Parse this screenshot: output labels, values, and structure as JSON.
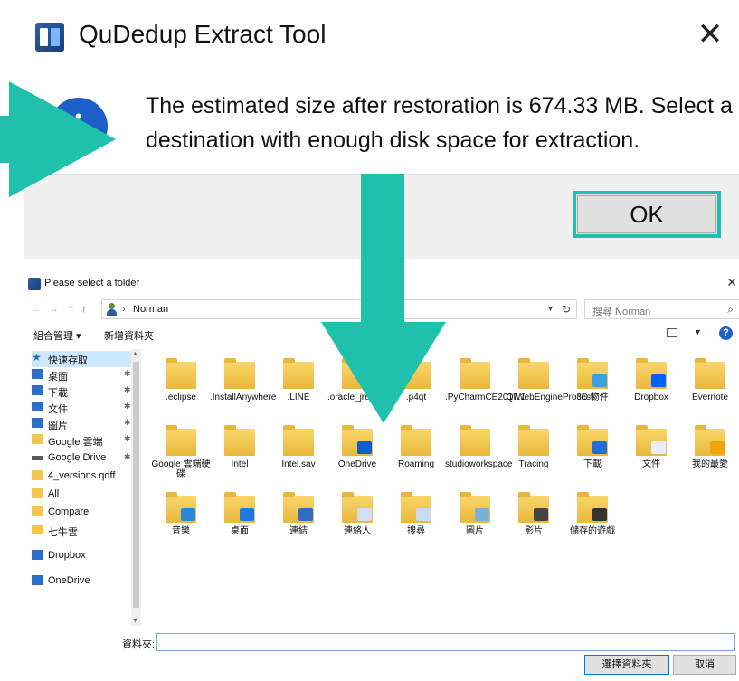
{
  "message_dialog": {
    "title": "QuDedup Extract Tool",
    "close_glyph": "✕",
    "icon": "info-icon",
    "message": "The estimated size after restoration is 674.33 MB. Select a destination with enough disk space for extraction.",
    "ok_label": "OK"
  },
  "annotation_color": "#1fc1ad",
  "folder_picker": {
    "title": "Please select a folder",
    "close_glyph": "✕",
    "nav": {
      "back": "←",
      "forward": "→",
      "recent": "⌄",
      "up": "↑",
      "path_sep": "›",
      "path": "Norman",
      "refresh": "↻"
    },
    "search_placeholder": "搜尋 Norman",
    "toolbar": {
      "organize": "組合管理 ▾",
      "new_folder": "新增資料夾"
    },
    "sidebar": [
      {
        "label": "快速存取",
        "icon": "star-icon",
        "pinned": false
      },
      {
        "label": "桌面",
        "icon": "desktop-icon",
        "pinned": true
      },
      {
        "label": "下載",
        "icon": "download-icon",
        "pinned": true
      },
      {
        "label": "文件",
        "icon": "documents-icon",
        "pinned": true
      },
      {
        "label": "圖片",
        "icon": "pictures-icon",
        "pinned": true
      },
      {
        "label": "Google 雲端",
        "icon": "folder-icon",
        "pinned": true
      },
      {
        "label": "Google Drive",
        "icon": "drive-icon",
        "pinned": true
      },
      {
        "label": "4_versions.qdff",
        "icon": "folder-icon",
        "pinned": false
      },
      {
        "label": "All",
        "icon": "folder-icon",
        "pinned": false
      },
      {
        "label": "Compare",
        "icon": "folder-icon",
        "pinned": false
      },
      {
        "label": "七牛雲",
        "icon": "folder-icon",
        "pinned": false
      },
      {
        "label": "Dropbox",
        "icon": "dropbox-icon",
        "pinned": false
      },
      {
        "label": "OneDrive",
        "icon": "onedrive-icon",
        "pinned": false
      }
    ],
    "pin_glyph": "✱",
    "files": [
      {
        "name": ".eclipse",
        "icon": "folder-icon"
      },
      {
        "name": ".InstallAnywhere",
        "icon": "folder-icon"
      },
      {
        "name": ".LINE",
        "icon": "folder-icon"
      },
      {
        "name": ".oracle_jre_usage",
        "icon": "folder-icon"
      },
      {
        "name": ".p4qt",
        "icon": "folder-icon"
      },
      {
        "name": ".PyCharmCE2017.1",
        "icon": "folder-icon"
      },
      {
        "name": ".QtWebEngineProcess",
        "icon": "folder-icon"
      },
      {
        "name": "3D 物件",
        "icon": "3d-objects-icon"
      },
      {
        "name": "Dropbox",
        "icon": "dropbox-folder-icon"
      },
      {
        "name": "Evernote",
        "icon": "folder-icon"
      },
      {
        "name": "Google 雲端硬碟",
        "icon": "folder-icon"
      },
      {
        "name": "Intel",
        "icon": "folder-icon"
      },
      {
        "name": "Intel.sav",
        "icon": "folder-icon"
      },
      {
        "name": "OneDrive",
        "icon": "onedrive-folder-icon"
      },
      {
        "name": "Roaming",
        "icon": "folder-icon"
      },
      {
        "name": "studioworkspace",
        "icon": "folder-icon"
      },
      {
        "name": "Tracing",
        "icon": "folder-icon"
      },
      {
        "name": "下載",
        "icon": "downloads-folder-icon"
      },
      {
        "name": "文件",
        "icon": "documents-folder-icon"
      },
      {
        "name": "我的最愛",
        "icon": "favorites-folder-icon"
      },
      {
        "name": "音樂",
        "icon": "music-folder-icon"
      },
      {
        "name": "桌面",
        "icon": "desktop-folder-icon"
      },
      {
        "name": "連結",
        "icon": "links-folder-icon"
      },
      {
        "name": "連絡人",
        "icon": "contacts-folder-icon"
      },
      {
        "name": "搜尋",
        "icon": "searches-folder-icon"
      },
      {
        "name": "圖片",
        "icon": "pictures-folder-icon"
      },
      {
        "name": "影片",
        "icon": "videos-folder-icon"
      },
      {
        "name": "儲存的遊戲",
        "icon": "saved-games-folder-icon"
      }
    ],
    "folder_label": "資料夾:",
    "folder_value": "",
    "select_button": "選擇資料夾",
    "cancel_button": "取消"
  }
}
